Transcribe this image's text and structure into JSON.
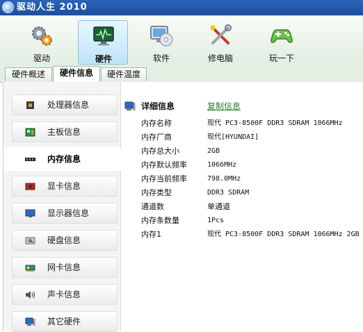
{
  "window": {
    "title": "驱动人生 2010"
  },
  "toolbar": {
    "items": [
      {
        "label": "驱动",
        "icon": "gears-icon"
      },
      {
        "label": "硬件",
        "icon": "monitor-pulse-icon"
      },
      {
        "label": "软件",
        "icon": "software-disc-icon"
      },
      {
        "label": "修电脑",
        "icon": "tools-icon"
      },
      {
        "label": "玩一下",
        "icon": "gamepad-icon"
      }
    ]
  },
  "tabs": [
    {
      "label": "硬件概述"
    },
    {
      "label": "硬件信息"
    },
    {
      "label": "硬件温度"
    }
  ],
  "sidebar": {
    "items": [
      {
        "label": "处理器信息",
        "icon": "cpu-icon"
      },
      {
        "label": "主板信息",
        "icon": "motherboard-icon"
      },
      {
        "label": "内存信息",
        "icon": "memory-icon"
      },
      {
        "label": "显卡信息",
        "icon": "graphics-card-icon"
      },
      {
        "label": "显示器信息",
        "icon": "display-icon"
      },
      {
        "label": "硬盘信息",
        "icon": "hard-disk-icon"
      },
      {
        "label": "网卡信息",
        "icon": "network-card-icon"
      },
      {
        "label": "声卡信息",
        "icon": "speaker-icon"
      },
      {
        "label": "其它硬件",
        "icon": "computer-icon"
      }
    ]
  },
  "detail": {
    "title": "详细信息",
    "copy_label": "复制信息",
    "rows": [
      {
        "key": "内存名称",
        "value": "现代 PC3-8500F DDR3 SDRAM 1066MHz"
      },
      {
        "key": "内存厂商",
        "value": "现代[HYUNDAI]"
      },
      {
        "key": "内存总大小",
        "value": "2GB"
      },
      {
        "key": "内存默认频率",
        "value": "1066MHz"
      },
      {
        "key": "内存当前频率",
        "value": "798.0MHz"
      },
      {
        "key": "内存类型",
        "value": "DDR3 SDRAM"
      },
      {
        "key": "通道数",
        "value": "单通道"
      },
      {
        "key": "内存条数量",
        "value": "1Pcs"
      },
      {
        "key": "内存1",
        "value": "现代 PC3-8500F DDR3 SDRAM 1066MHz 2GB"
      }
    ]
  }
}
